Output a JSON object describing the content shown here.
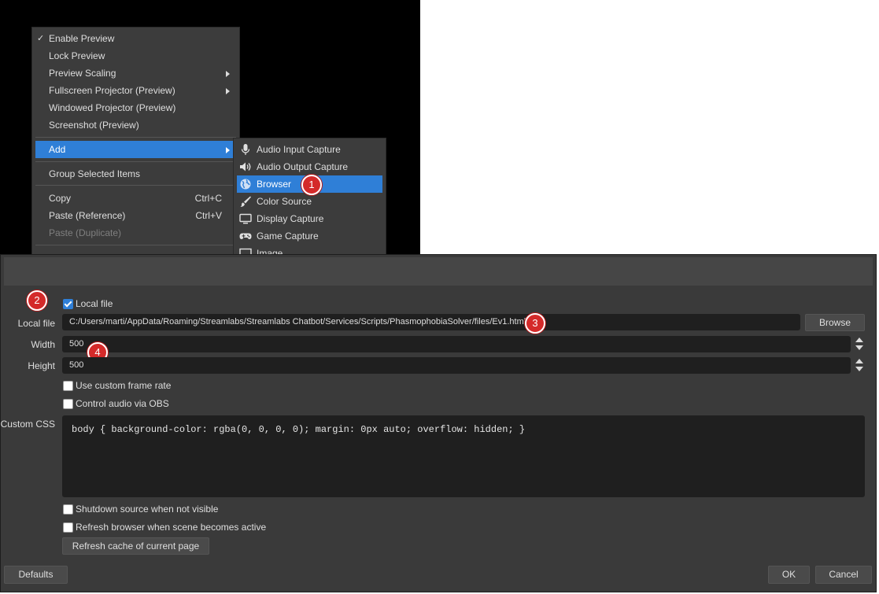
{
  "context_menu": {
    "items": [
      {
        "label": "Enable Preview",
        "checked": true
      },
      {
        "label": "Lock Preview"
      },
      {
        "label": "Preview Scaling",
        "submenu": true
      },
      {
        "label": "Fullscreen Projector (Preview)",
        "submenu": true
      },
      {
        "label": "Windowed Projector (Preview)"
      },
      {
        "label": "Screenshot (Preview)"
      },
      {
        "label": "Add",
        "submenu": true,
        "active": true
      },
      {
        "label": "Group Selected Items"
      },
      {
        "label": "Copy",
        "shortcut": "Ctrl+C"
      },
      {
        "label": "Paste (Reference)",
        "shortcut": "Ctrl+V"
      },
      {
        "label": "Paste (Duplicate)",
        "disabled": true
      }
    ],
    "check_glyph": "✓"
  },
  "add_submenu": {
    "items": [
      {
        "label": "Audio Input Capture",
        "icon": "microphone-icon"
      },
      {
        "label": "Audio Output Capture",
        "icon": "speaker-icon"
      },
      {
        "label": "Browser",
        "icon": "globe-icon",
        "active": true
      },
      {
        "label": "Color Source",
        "icon": "paintbrush-icon"
      },
      {
        "label": "Display Capture",
        "icon": "monitor-icon"
      },
      {
        "label": "Game Capture",
        "icon": "gamepad-icon"
      },
      {
        "label": "Image",
        "icon": "image-icon"
      }
    ]
  },
  "callouts": [
    "1",
    "2",
    "3",
    "4"
  ],
  "dialog": {
    "local_file_checkbox": {
      "label": "Local file",
      "checked": true
    },
    "local_file_label": "Local file",
    "local_file_path": "C:/Users/marti/AppData/Roaming/Streamlabs/Streamlabs Chatbot/Services/Scripts/PhasmophobiaSolver/files/Ev1.html",
    "browse_label": "Browse",
    "width_label": "Width",
    "width_value": "500",
    "height_label": "Height",
    "height_value": "500",
    "custom_frame_rate": {
      "label": "Use custom frame rate",
      "checked": false
    },
    "control_audio": {
      "label": "Control audio via OBS",
      "checked": false
    },
    "custom_css_label": "Custom CSS",
    "custom_css_value": "body { background-color: rgba(0, 0, 0, 0); margin: 0px auto; overflow: hidden; }",
    "shutdown_source": {
      "label": "Shutdown source when not visible",
      "checked": false
    },
    "refresh_browser": {
      "label": "Refresh browser when scene becomes active",
      "checked": false
    },
    "refresh_cache_label": "Refresh cache of current page",
    "defaults_label": "Defaults",
    "ok_label": "OK",
    "cancel_label": "Cancel"
  },
  "colors": {
    "accent": "#2f7fd7",
    "callout": "#d42a2a",
    "dialog_bg": "#3a3a3a",
    "menu_bg": "#3c3c3c"
  }
}
